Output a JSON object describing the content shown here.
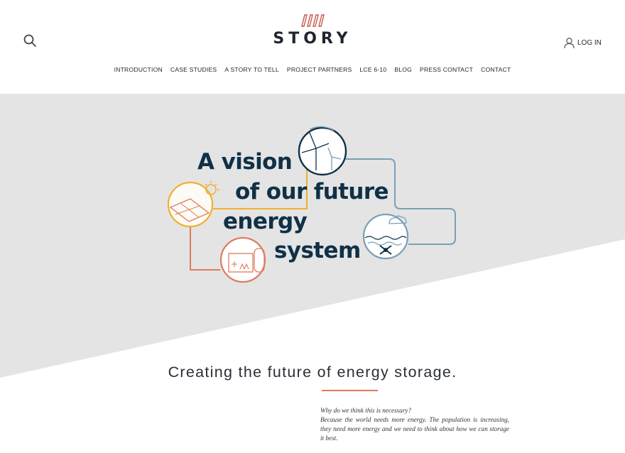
{
  "header": {
    "logo_text": "STORY",
    "login_label": "LOG IN"
  },
  "nav": {
    "items": [
      {
        "label": "INTRODUCTION"
      },
      {
        "label": "CASE STUDIES"
      },
      {
        "label": "A STORY TO TELL"
      },
      {
        "label": "PROJECT PARTNERS"
      },
      {
        "label": "LCE 6-10"
      },
      {
        "label": "BLOG"
      },
      {
        "label": "PRESS CONTACT"
      },
      {
        "label": "CONTACT"
      }
    ]
  },
  "hero": {
    "line1": "A vision",
    "line2": "of our future",
    "line3": "energy",
    "line4": "system"
  },
  "content": {
    "tagline": "Creating the future of energy storage.",
    "question": "Why do we think this is necessary?",
    "answer": "Because the world needs more energy. The population is increasing, they need more energy and we need to think about how we can storage it best."
  },
  "colors": {
    "navy": "#0f3147",
    "accent_orange": "#e07a5f",
    "hero_gray": "#e4e4e4",
    "solar_yellow": "#f0b030",
    "water_blue": "#7a9fb5"
  }
}
